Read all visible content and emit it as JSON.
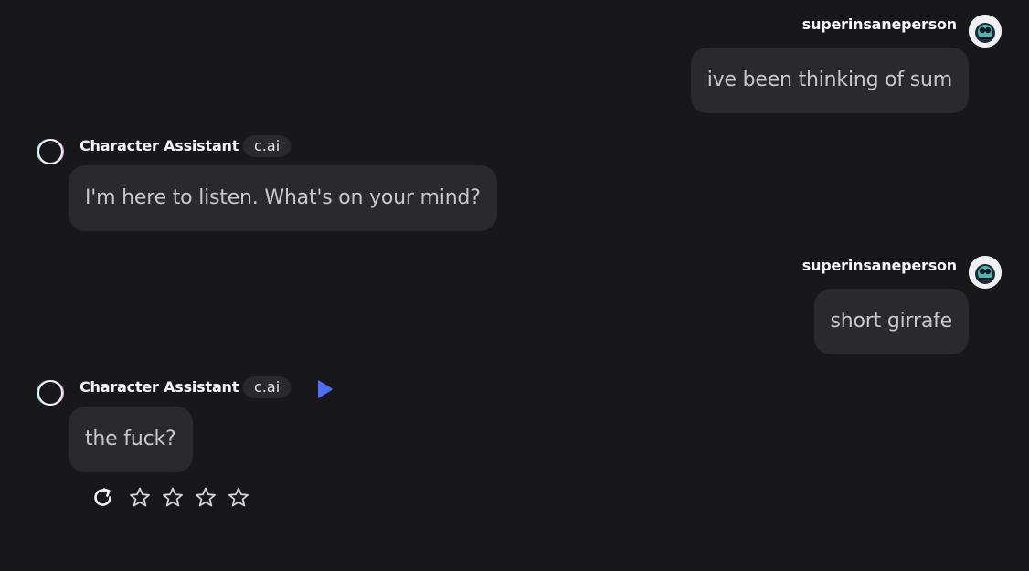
{
  "messages": [
    {
      "role": "user",
      "author": "superinsaneperson",
      "text": "ive been thinking of sum"
    },
    {
      "role": "bot",
      "author": "Character Assistant",
      "badge": "c.ai",
      "text": "I'm here to listen. What's on your mind?"
    },
    {
      "role": "user",
      "author": "superinsaneperson",
      "text": "short girrafe"
    },
    {
      "role": "bot",
      "author": "Character Assistant",
      "badge": "c.ai",
      "text": "the fuck?"
    }
  ],
  "actions": {
    "icons": [
      "refresh-icon",
      "star-icon",
      "star-icon",
      "star-icon",
      "star-icon"
    ],
    "rating": 0,
    "rating_max": 4
  },
  "colors": {
    "background": "#18181b",
    "bubble": "#2a2a2e",
    "bubble_text": "#c7c7cc",
    "play_accent": "#4f6ef7"
  }
}
